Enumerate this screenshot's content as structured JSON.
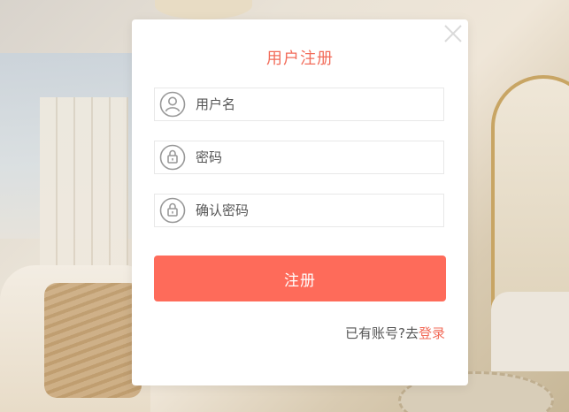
{
  "modal": {
    "title": "用户注册",
    "close_icon": "close-icon"
  },
  "form": {
    "username": {
      "placeholder": "用户名",
      "value": "",
      "icon": "user-icon"
    },
    "password": {
      "placeholder": "密码",
      "value": "",
      "icon": "lock-icon"
    },
    "confirm_password": {
      "placeholder": "确认密码",
      "value": "",
      "icon": "lock-icon"
    },
    "submit_label": "注册"
  },
  "footer": {
    "prompt": "已有账号?去",
    "login_link": "登录"
  },
  "colors": {
    "accent": "#fe6b5a",
    "title": "#f26c5a",
    "icon": "#999999"
  }
}
